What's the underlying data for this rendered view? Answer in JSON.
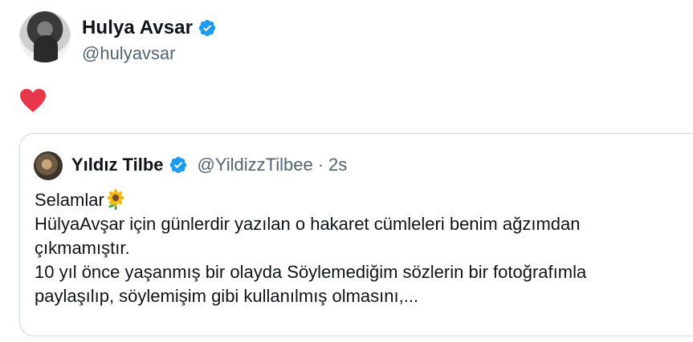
{
  "author": {
    "name": "Hulya Avsar",
    "handle": "@hulyavsar"
  },
  "post": {
    "emoji_icon": "red-heart-icon"
  },
  "quoted": {
    "name": "Yıldız Tilbe",
    "handle": "@YildizzTilbee",
    "separator": "·",
    "time": "2s",
    "lines": [
      "Selamlar",
      "HülyaAvşar için günlerdir yazılan o hakaret cümleleri benim ağzımdan",
      "çıkmamıştır.",
      "10 yıl önce yaşanmış bir olayda Söylemediğim sözlerin bir fotoğrafımla",
      "paylaşılıp, söylemişim gibi kullanılmış olmasını,..."
    ]
  },
  "colors": {
    "verified": "#1d9bf0",
    "secondary_text": "#536471",
    "border": "#cfd9de",
    "heart": "#f91880"
  }
}
